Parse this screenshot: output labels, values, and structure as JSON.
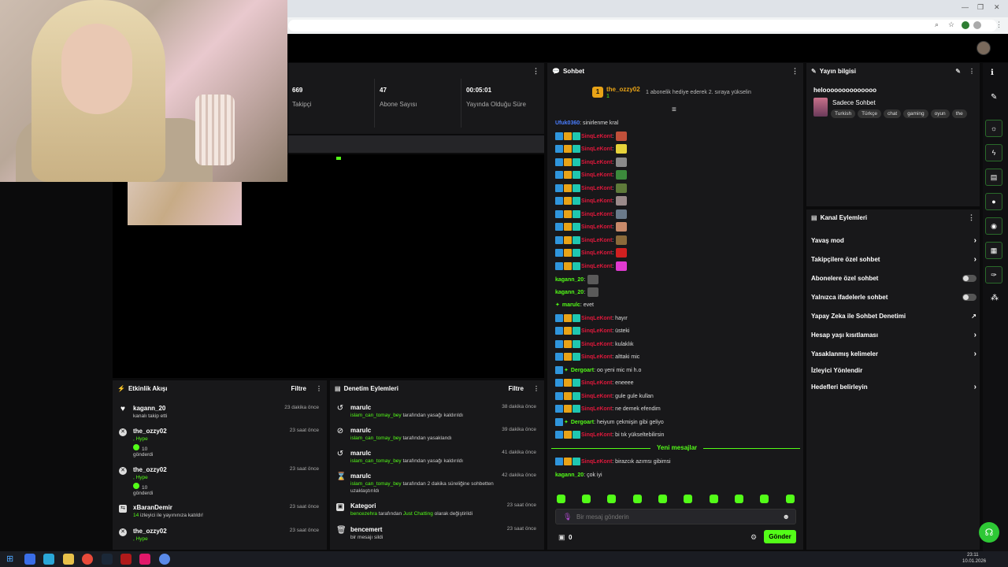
{
  "browser": {
    "zoom_icon": "search-icon",
    "star_icon": "star-icon"
  },
  "stats": [
    {
      "value": "669",
      "label": "Takipçi"
    },
    {
      "value": "47",
      "label": "Abone Sayısı"
    },
    {
      "value": "00:05:01",
      "label": "Yayında Olduğu Süre"
    }
  ],
  "activity": {
    "title": "Etkinlik Akışı",
    "filter": "Filtre",
    "items": [
      {
        "name": "kagann_20",
        "sub": "kanalı takip etti",
        "time": "23 dakika önce"
      },
      {
        "name": "the_ozzy02",
        "sub": ", Hype",
        "sub2": "10",
        "sub3": "gönderdi",
        "time": "23 saat önce"
      },
      {
        "name": "the_ozzy02",
        "sub": ", Hype",
        "sub2": "10",
        "sub3": "gönderdi",
        "time": "23 saat önce"
      },
      {
        "name": "xBaranDemir",
        "sub_green": "14",
        "sub": "izleyici ile yayınınıza katıldı!",
        "time": "23 saat önce"
      },
      {
        "name": "the_ozzy02",
        "sub": ", Hype",
        "time": "23 saat önce"
      }
    ]
  },
  "moderation": {
    "title": "Denetim Eylemleri",
    "filter": "Filtre",
    "items": [
      {
        "name": "marulc",
        "user": "islam_can_tomay_bey",
        "sub": "tarafından yasağı kaldırıldı",
        "time": "38 dakika önce"
      },
      {
        "name": "marulc",
        "user": "islam_can_tomay_bey",
        "sub": "tarafından yasaklandı",
        "time": "39 dakika önce"
      },
      {
        "name": "marulc",
        "user": "islam_can_tomay_bey",
        "sub": "tarafından yasağı kaldırıldı",
        "time": "41 dakika önce"
      },
      {
        "name": "marulc",
        "user": "islam_can_tomay_bey",
        "sub": "tarafından 2 dakika süreliğine sohbetten",
        "sub_b": "uzaklaştırıldı",
        "time": "42 dakika önce"
      },
      {
        "name": "Kategori",
        "user": "bencezehra",
        "sub": "tarafından",
        "cat": "Just Chatting",
        "sub_c": "olarak değiştirildi",
        "time": "23 saat önce"
      },
      {
        "name": "bencemert",
        "sub": "bir mesajı sildi",
        "time": "23 saat önce"
      }
    ]
  },
  "chat": {
    "title": "Sohbet",
    "pinned_user": "the_ozzy02",
    "pinned_count": "1",
    "pinned_msg": "1 abonelik hediye ederek 2. sıraya yükselin",
    "lines": [
      {
        "user": "Ufuk0360",
        "color": "blue",
        "badges": false,
        "text": ": sinirlenme kral"
      },
      {
        "user": "SinqLeKont",
        "color": "red",
        "badges": true,
        "text": ":",
        "emote": "#c0503a"
      },
      {
        "user": "SinqLeKont",
        "color": "red",
        "badges": true,
        "text": ":",
        "emote": "#e6d23a"
      },
      {
        "user": "SinqLeKont",
        "color": "red",
        "badges": true,
        "text": ":",
        "emote": "#8a8a8a"
      },
      {
        "user": "SinqLeKont",
        "color": "red",
        "badges": true,
        "text": ":",
        "emote": "#3c8a3c"
      },
      {
        "user": "SinqLeKont",
        "color": "red",
        "badges": true,
        "text": ":",
        "emote": "#5e7a3a"
      },
      {
        "user": "SinqLeKont",
        "color": "red",
        "badges": true,
        "text": ":",
        "emote": "#9a8a8a"
      },
      {
        "user": "SinqLeKont",
        "color": "red",
        "badges": true,
        "text": ":",
        "emote": "#6a7a8a"
      },
      {
        "user": "SinqLeKont",
        "color": "red",
        "badges": true,
        "text": ":",
        "emote": "#c88a6a"
      },
      {
        "user": "SinqLeKont",
        "color": "red",
        "badges": true,
        "text": ":",
        "emote": "#8a6a3a"
      },
      {
        "user": "SinqLeKont",
        "color": "red",
        "badges": true,
        "text": ":",
        "emote": "#d02020"
      },
      {
        "user": "SinqLeKont",
        "color": "red",
        "badges": true,
        "text": ":",
        "emote": "#e03ad0"
      },
      {
        "user": "kagann_20",
        "color": "green",
        "badges": false,
        "text": ":",
        "emote": "#5a5a5a"
      },
      {
        "user": "kagann_20",
        "color": "green",
        "badges": false,
        "text": ":",
        "emote": "#5a5a5a"
      },
      {
        "user": "marulc",
        "color": "green",
        "badges": false,
        "star": true,
        "text": ": evet"
      },
      {
        "user": "SinqLeKont",
        "color": "red",
        "badges": true,
        "text": ": hayır"
      },
      {
        "user": "SinqLeKont",
        "color": "red",
        "badges": true,
        "text": ": üsteki"
      },
      {
        "user": "SinqLeKont",
        "color": "red",
        "badges": true,
        "text": ": kulaklık"
      },
      {
        "user": "SinqLeKont",
        "color": "red",
        "badges": true,
        "text": ": alttaki mic"
      },
      {
        "user": "Dergoart",
        "color": "green",
        "badges": "one",
        "star": true,
        "text": ": oo yeni mic mi h.o"
      },
      {
        "user": "SinqLeKont",
        "color": "red",
        "badges": true,
        "text": ": eneeee"
      },
      {
        "user": "SinqLeKont",
        "color": "red",
        "badges": true,
        "text": ": gule gule kullan"
      },
      {
        "user": "SinqLeKont",
        "color": "red",
        "badges": true,
        "text": ": ne demek efendim"
      },
      {
        "user": "Dergoart",
        "color": "green",
        "badges": "one",
        "star": true,
        "text": ": heiyum çekmişin gibi geliyo"
      },
      {
        "user": "SinqLeKont",
        "color": "red",
        "badges": true,
        "text": ": bi tık yükseltebilirsin"
      }
    ],
    "new_messages": "Yeni mesajlar",
    "after_lines": [
      {
        "user": "SinqLeKont",
        "color": "red",
        "badges": true,
        "text": ": birazcık azımsı gibimsi"
      },
      {
        "user": "kagann_20",
        "color": "green",
        "badges": false,
        "text": ": çok iyi"
      }
    ],
    "input_placeholder": "Bir mesaj gönderin",
    "count": "0",
    "send": "Gönder"
  },
  "stream_info": {
    "title": "Yayın bilgisi",
    "stream_title": "heloooooooooooooo",
    "category": "Sadece Sohbet",
    "tags": [
      "Turkish",
      "Türkçe",
      "chat",
      "gaming",
      "oyun",
      "the"
    ]
  },
  "channel_actions": {
    "title": "Kanal Eylemleri",
    "items": [
      {
        "label": "Yavaş mod",
        "kind": "chevron"
      },
      {
        "label": "Takipçilere özel sohbet",
        "kind": "chevron"
      },
      {
        "label": "Abonelere özel sohbet",
        "kind": "toggle"
      },
      {
        "label": "Yalnızca ifadelerle sohbet",
        "kind": "toggle"
      },
      {
        "label": "Yapay Zeka ile Sohbet Denetimi",
        "kind": "external"
      },
      {
        "label": "Hesap yaşı kısıtlaması",
        "kind": "chevron"
      },
      {
        "label": "Yasaklanmış kelimeler",
        "kind": "chevron"
      },
      {
        "label": "İzleyici Yönlendir",
        "kind": "none"
      },
      {
        "label": "Hedefleri belirleyin",
        "kind": "chevron"
      }
    ]
  },
  "taskbar": {
    "time": "23:11",
    "date": "10.01.2026"
  },
  "colors": {
    "accent": "#53fc18",
    "panel": "#18181a",
    "bg": "#0b0b0c"
  }
}
